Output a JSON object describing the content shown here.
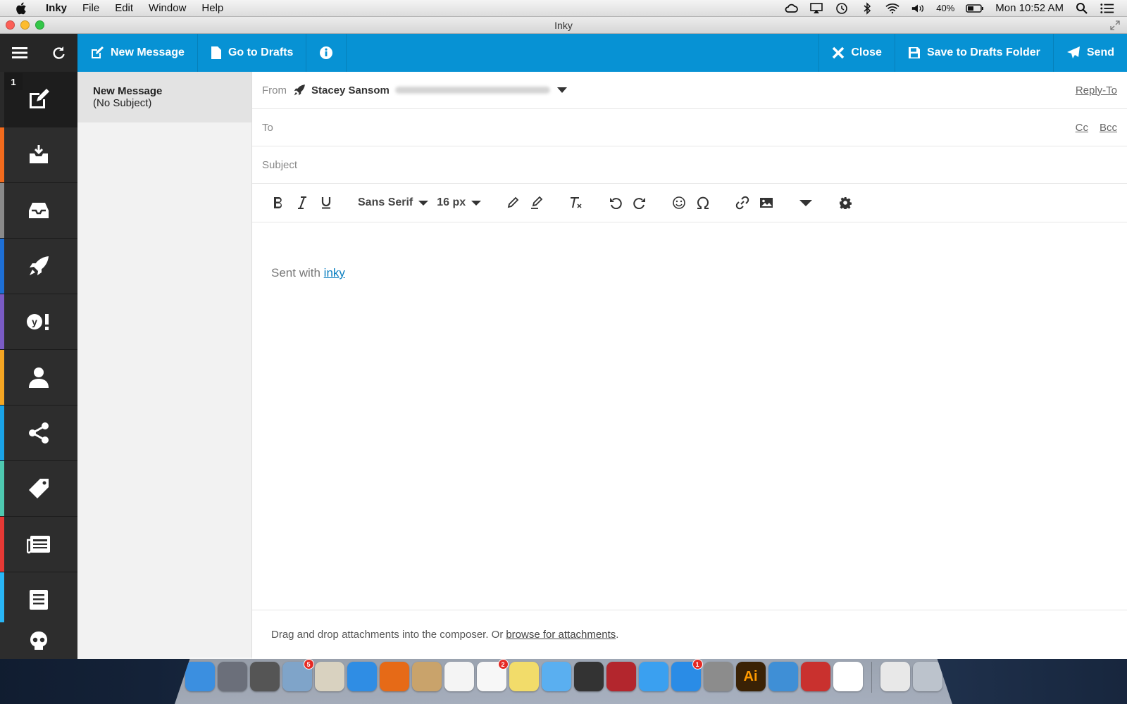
{
  "menubar": {
    "app_name": "Inky",
    "menus": [
      "File",
      "Edit",
      "Window",
      "Help"
    ],
    "battery": "40%",
    "clock": "Mon 10:52 AM"
  },
  "window": {
    "title": "Inky"
  },
  "toolbar": {
    "new_message": "New Message",
    "go_to_drafts": "Go to Drafts",
    "close": "Close",
    "save_drafts": "Save to Drafts Folder",
    "send": "Send"
  },
  "rail": {
    "badge": "1",
    "accent_colors": [
      "#2a2a2a",
      "#f26b1d",
      "#8a8a8a",
      "#1d6fd6",
      "#7a5bc4",
      "#f5a623",
      "#1aa3e8",
      "#4ec9b0",
      "#e53935",
      "#29b6f6"
    ]
  },
  "messages": [
    {
      "title": "New Message",
      "subtitle": "(No Subject)"
    }
  ],
  "composer": {
    "from_label": "From",
    "from_name": "Stacey Sansom",
    "reply_to": "Reply-To",
    "to_label": "To",
    "cc": "Cc",
    "bcc": "Bcc",
    "subject_label": "Subject",
    "font_family": "Sans Serif",
    "font_size": "16 px",
    "body_text": "Sent with",
    "body_link": "inky",
    "attach_text": "Drag and drop attachments into the composer. Or",
    "attach_link": "browse for attachments",
    "attach_end": "."
  },
  "dock": {
    "items": [
      {
        "name": "finder-icon",
        "color": "#3b8fe0"
      },
      {
        "name": "launchpad-icon",
        "color": "#6b6f7a"
      },
      {
        "name": "photo-booth-icon",
        "color": "#555"
      },
      {
        "name": "mail-icon",
        "color": "#7fa4c9",
        "badge": "5"
      },
      {
        "name": "directory-utility-icon",
        "color": "#d9d2c0"
      },
      {
        "name": "safari-icon",
        "color": "#2f8de4"
      },
      {
        "name": "firefox-icon",
        "color": "#e66a17"
      },
      {
        "name": "contacts-icon",
        "color": "#c9a36b"
      },
      {
        "name": "calendar-icon",
        "color": "#f4f4f4"
      },
      {
        "name": "reminders-icon",
        "color": "#f7f7f7",
        "badge": "2"
      },
      {
        "name": "stickies-icon",
        "color": "#f2dc6a"
      },
      {
        "name": "messages-icon",
        "color": "#5aaff0"
      },
      {
        "name": "facetime-icon",
        "color": "#333"
      },
      {
        "name": "photo-icon",
        "color": "#b3262d"
      },
      {
        "name": "itunes-icon",
        "color": "#3aa0f0"
      },
      {
        "name": "app-store-icon",
        "color": "#2a8ce6",
        "badge": "1"
      },
      {
        "name": "system-preferences-icon",
        "color": "#8c8c8c"
      },
      {
        "name": "illustrator-icon",
        "color": "#3a2205",
        "text": "Ai"
      },
      {
        "name": "sourcetree-icon",
        "color": "#3f8fd6"
      },
      {
        "name": "filezilla-icon",
        "color": "#c9312e"
      },
      {
        "name": "inky-icon",
        "color": "#fff"
      },
      {
        "name": "document-icon",
        "color": "#e8e8e8"
      },
      {
        "name": "trash-icon",
        "color": "#bcc3cc"
      }
    ]
  }
}
